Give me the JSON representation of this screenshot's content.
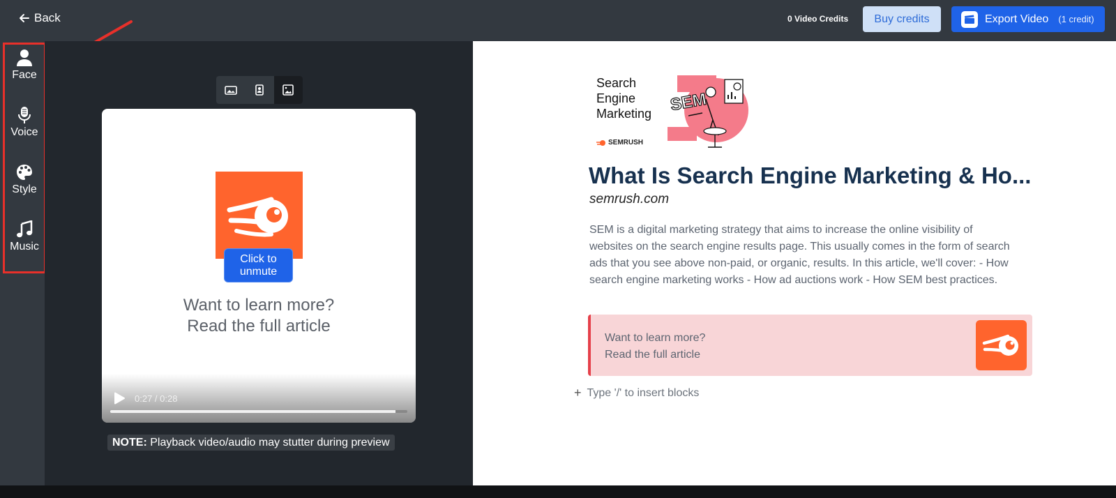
{
  "topbar": {
    "back_label": "Back",
    "credits_label": "0 Video Credits",
    "buy_label": "Buy credits",
    "export_label": "Export Video",
    "export_sub": "(1 credit)"
  },
  "sidebar": {
    "items": [
      {
        "label": "Face",
        "icon": "person-icon"
      },
      {
        "label": "Voice",
        "icon": "microphone-icon"
      },
      {
        "label": "Style",
        "icon": "palette-icon"
      },
      {
        "label": "Music",
        "icon": "music-note-icon"
      }
    ]
  },
  "annotation": {
    "color": "#e8302a"
  },
  "preview": {
    "unmute_label_1": "Click to",
    "unmute_label_2": "unmute",
    "cta_line1": "Want to learn more?",
    "cta_line2": "Read the full article",
    "time": "0:27 / 0:28",
    "progress": 0.96,
    "note_bold": "NOTE:",
    "note_text": " Playback video/audio may stutter during preview"
  },
  "article": {
    "thumb_line1": "Search",
    "thumb_line2": "Engine",
    "thumb_line3": "Marketing",
    "thumb_brand": "SEMRUSH",
    "thumb_art_text": "SEM",
    "title": "What Is Search Engine Marketing & Ho...",
    "domain": "semrush.com",
    "description": "SEM is a digital marketing strategy that aims to increase the online visibility of websites on the search engine results page. This usually comes in the form of search ads that you see above non-paid, or organic, results. In this article, we'll cover: - How search engine marketing works - How ad auctions work - How SEM best practices.",
    "callout_line1": "Want to learn more?",
    "callout_line2": "Read the full article",
    "add_block_placeholder": "Type '/' to insert blocks"
  },
  "colors": {
    "brand_orange": "#ff642d",
    "primary_blue": "#1f63e8",
    "title_navy": "#17314f",
    "callout_bg": "#f8d5d7",
    "callout_border": "#e5404a"
  }
}
